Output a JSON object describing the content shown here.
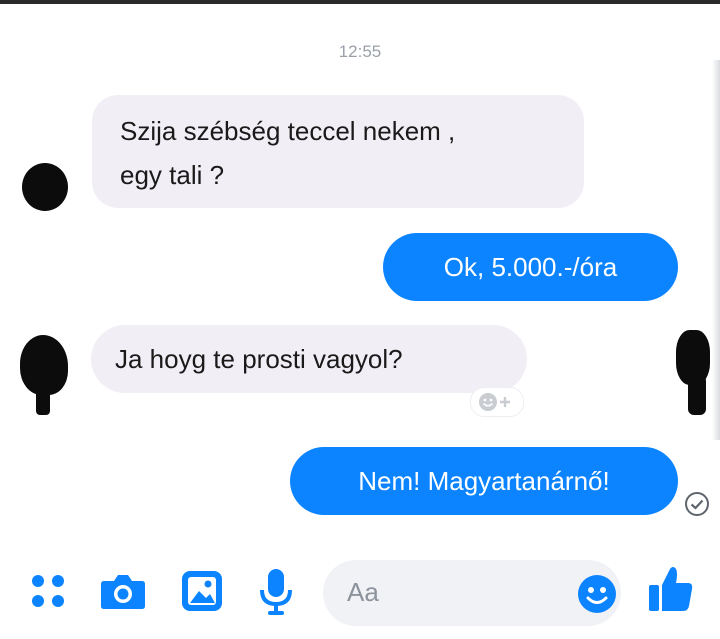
{
  "conversation": {
    "timestamp": "12:55",
    "messages": [
      {
        "sender": "other",
        "lines": [
          "Szija szébség teccel nekem ,",
          "egy tali ?"
        ]
      },
      {
        "sender": "me",
        "text": "Ok, 5.000.-/óra"
      },
      {
        "sender": "other",
        "text": "Ja hoyg te prosti vagyol?"
      },
      {
        "sender": "me",
        "text": "Nem! Magyartanárnő!"
      }
    ],
    "reaction_button_icon": "add-reaction-icon",
    "seen_status_icon": "check-circle-icon"
  },
  "composer": {
    "placeholder": "Aa",
    "tools": [
      "more-icon",
      "camera-icon",
      "gallery-icon",
      "microphone-icon"
    ],
    "emoji_icon": "emoji-icon",
    "send_icon": "thumbs-up-icon"
  },
  "colors": {
    "accent": "#0c84ff",
    "incoming_bubble": "#f1eff5",
    "timestamp": "#9aa0a8"
  }
}
